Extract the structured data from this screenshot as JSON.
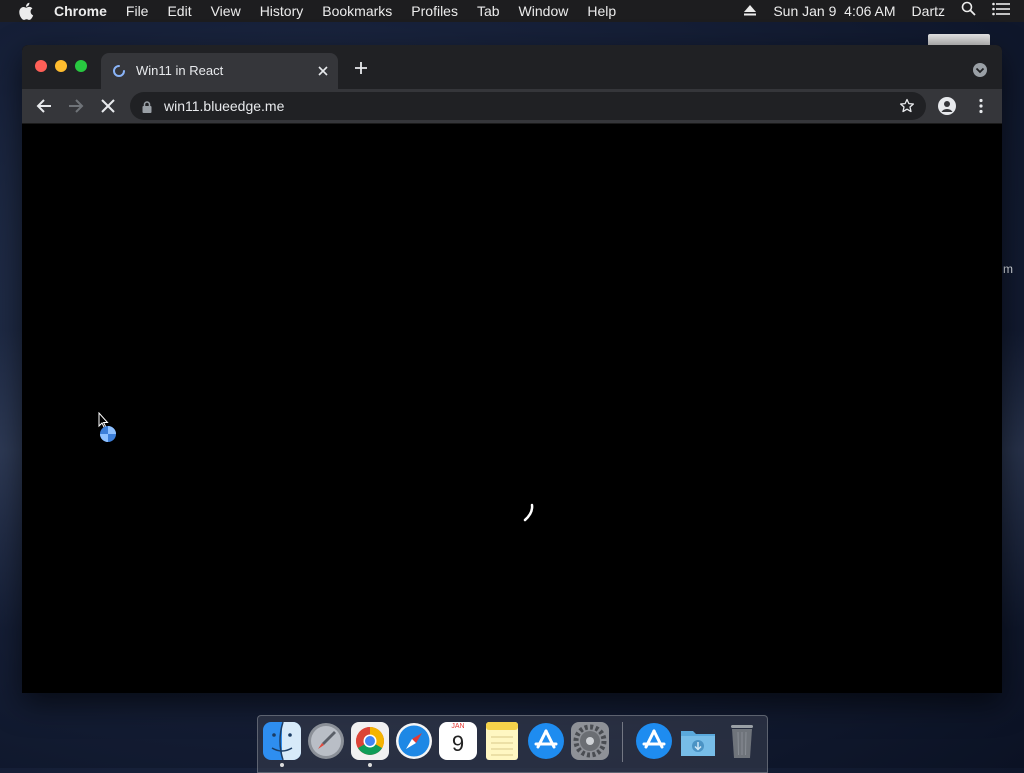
{
  "menubar": {
    "app_name": "Chrome",
    "items": [
      "File",
      "Edit",
      "View",
      "History",
      "Bookmarks",
      "Profiles",
      "Tab",
      "Window",
      "Help"
    ],
    "datetime": "Sun Jan 9  4:06 AM",
    "user": "Dartz"
  },
  "browser": {
    "tab_title": "Win11 in React",
    "url": "win11.blueedge.me"
  },
  "dock": {
    "calendar_month": "JAN",
    "calendar_day": "9"
  },
  "colors": {
    "menubar_bg": "#1d1d1f",
    "tabstrip_bg": "#202124",
    "toolbar_bg": "#35363a",
    "page_bg": "#000000"
  }
}
